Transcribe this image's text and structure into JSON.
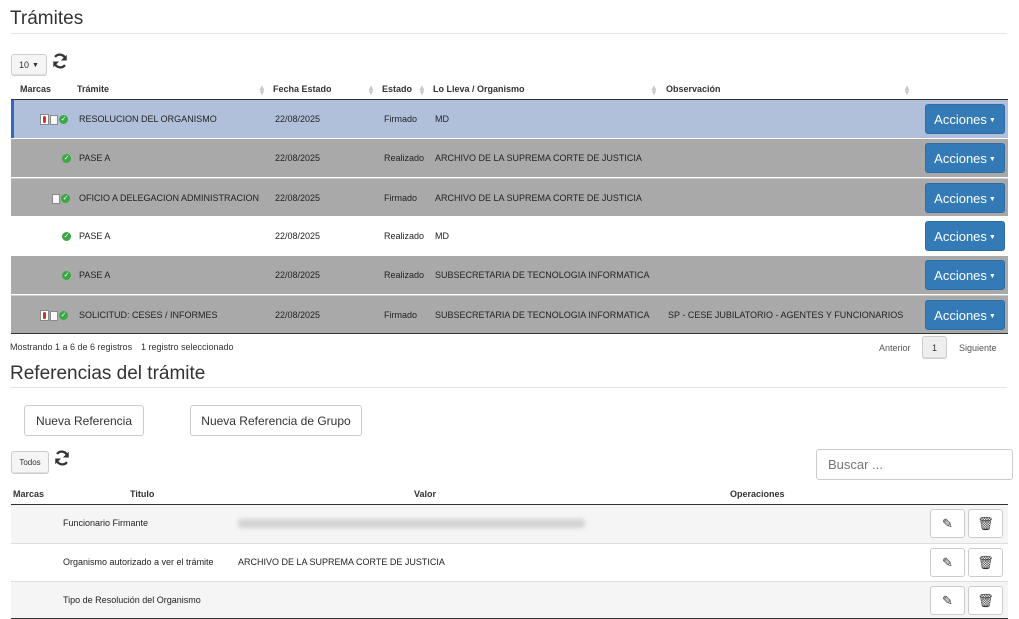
{
  "tramites": {
    "title": "Trámites",
    "page_size": "10",
    "columns": {
      "marcas": "Marcas",
      "tramite": "Trámite",
      "fecha": "Fecha Estado",
      "estado": "Estado",
      "lleva": "Lo Lleva / Organismo",
      "observacion": "Observación"
    },
    "rows": [
      {
        "tramite": "RESOLUCION DEL ORGANISMO",
        "fecha": "22/08/2025",
        "estado": "Firmado",
        "lleva": "MD",
        "observacion": "",
        "acciones": "Acciones"
      },
      {
        "tramite": "PASE A",
        "fecha": "22/08/2025",
        "estado": "Realizado",
        "lleva": "ARCHIVO DE LA SUPREMA CORTE DE JUSTICIA",
        "observacion": "",
        "acciones": "Acciones"
      },
      {
        "tramite": "OFICIO A DELEGACION ADMINISTRACION",
        "fecha": "22/08/2025",
        "estado": "Firmado",
        "lleva": "ARCHIVO DE LA SUPREMA CORTE DE JUSTICIA",
        "observacion": "",
        "acciones": "Acciones"
      },
      {
        "tramite": "PASE A",
        "fecha": "22/08/2025",
        "estado": "Realizado",
        "lleva": "MD",
        "observacion": "",
        "acciones": "Acciones"
      },
      {
        "tramite": "PASE A",
        "fecha": "22/08/2025",
        "estado": "Realizado",
        "lleva": "SUBSECRETARIA DE TECNOLOGIA INFORMATICA",
        "observacion": "",
        "acciones": "Acciones"
      },
      {
        "tramite": "SOLICITUD: CESES / INFORMES",
        "fecha": "22/08/2025",
        "estado": "Firmado",
        "lleva": "SUBSECRETARIA DE TECNOLOGIA INFORMATICA",
        "observacion": "SP - CESE JUBILATORIO - AGENTES Y FUNCIONARIOS",
        "acciones": "Acciones"
      }
    ],
    "info": "Mostrando 1 a 6 de 6 registros",
    "selected_info": "1 registro seleccionado",
    "pagination": {
      "prev": "Anterior",
      "page": "1",
      "next": "Siguiente"
    }
  },
  "referencias": {
    "title": "Referencias del trámite",
    "new_ref": "Nueva Referencia",
    "new_group_ref": "Nueva Referencia de Grupo",
    "filter": "Todos",
    "search_placeholder": "Buscar ...",
    "columns": {
      "marcas": "Marcas",
      "titulo": "Titulo",
      "valor": "Valor",
      "operaciones": "Operaciones"
    },
    "rows": [
      {
        "titulo": "Funcionario Firmante",
        "valor": ""
      },
      {
        "titulo": "Organismo autorizado a ver el trámite",
        "valor": "ARCHIVO DE LA SUPREMA CORTE DE JUSTICIA"
      },
      {
        "titulo": "Tipo de Resolución del Organismo",
        "valor": ""
      }
    ]
  },
  "icons": {
    "refresh": "refresh-icon",
    "edit": "pencil-icon",
    "delete": "trash-icon",
    "check": "check-circle-icon",
    "document": "document-icon",
    "signature": "signature-icon"
  },
  "colors": {
    "accent": "#337ab7",
    "selected_row": "#b1c0da",
    "grey_row": "#a9a9a9"
  }
}
